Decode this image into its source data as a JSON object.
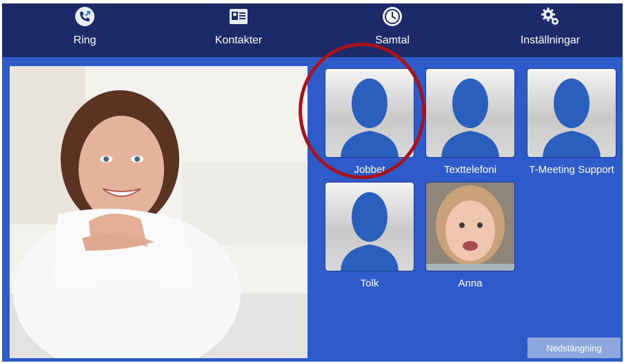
{
  "nav": {
    "items": [
      {
        "label": "Ring",
        "icon": "phone-call-icon"
      },
      {
        "label": "Kontakter",
        "icon": "contact-card-icon"
      },
      {
        "label": "Samtal",
        "icon": "clock-icon"
      },
      {
        "label": "Inställningar",
        "icon": "gear-icon"
      }
    ]
  },
  "contacts": [
    {
      "name": "Jobbet",
      "avatar": "silhouette"
    },
    {
      "name": "Texttelefoni",
      "avatar": "silhouette"
    },
    {
      "name": "T-Meeting Support",
      "avatar": "silhouette"
    },
    {
      "name": "Tolk",
      "avatar": "silhouette"
    },
    {
      "name": "Anna",
      "avatar": "photo"
    }
  ],
  "footer": {
    "shutdown_label": "Nedstängning"
  },
  "colors": {
    "background": "#2d5bc9",
    "topbar": "#1c2a6a",
    "highlight_circle": "#a8131b"
  }
}
